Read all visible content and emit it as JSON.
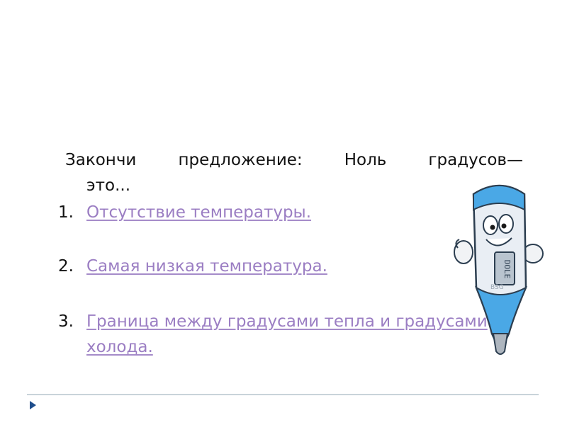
{
  "prompt": {
    "words": [
      "Закончи",
      "предложение:",
      "Ноль",
      "градусов—"
    ],
    "continuation": "это..."
  },
  "answers": [
    {
      "number": "1.",
      "text": "Отсутствие температуры."
    },
    {
      "number": "2.",
      "text": "Самая низкая температура."
    },
    {
      "number": "3.",
      "text": "Граница между градусами тепла и градусами холода."
    }
  ],
  "thermometer": {
    "display_text": "DOLE",
    "brand_text": "BSG",
    "colors": {
      "body": "#e9eef4",
      "cap": "#4aa8e6",
      "outline": "#2c3e50",
      "display": "#b9c4cf"
    }
  },
  "footer": {
    "arrow_color": "#1f4e8c",
    "line_color": "#c9d3da"
  }
}
